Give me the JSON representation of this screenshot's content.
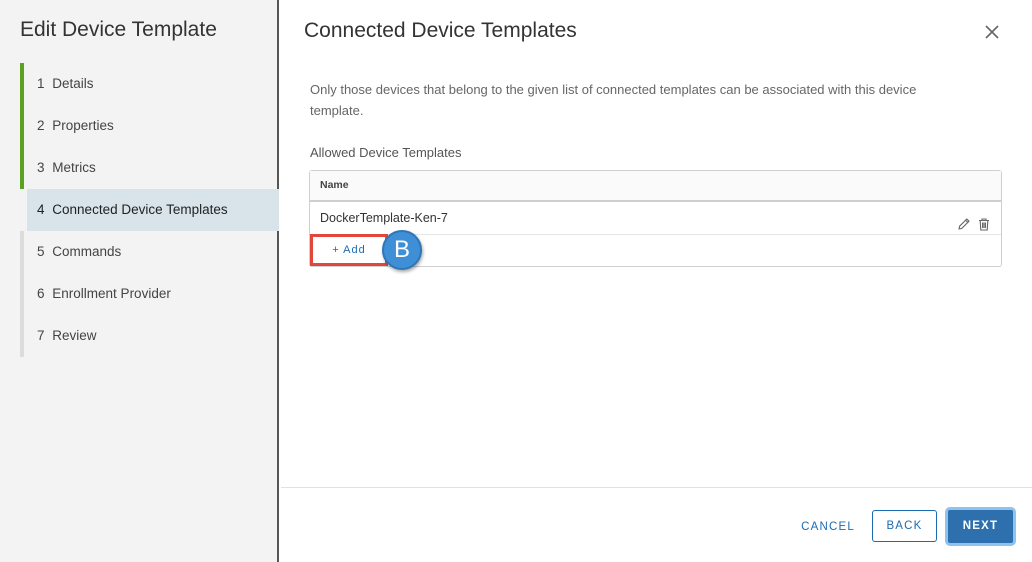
{
  "sidebar": {
    "title": "Edit Device Template",
    "steps": [
      {
        "num": "1",
        "label": "Details"
      },
      {
        "num": "2",
        "label": "Properties"
      },
      {
        "num": "3",
        "label": "Metrics"
      },
      {
        "num": "4",
        "label": "Connected Device Templates"
      },
      {
        "num": "5",
        "label": "Commands"
      },
      {
        "num": "6",
        "label": "Enrollment Provider"
      },
      {
        "num": "7",
        "label": "Review"
      }
    ]
  },
  "main": {
    "title": "Connected Device Templates",
    "description": "Only those devices that belong to the given list of connected templates can be associated with this device template.",
    "section_label": "Allowed Device Templates",
    "grid": {
      "column_header": "Name",
      "rows": [
        "DockerTemplate-Ken-7"
      ]
    },
    "add_label": "+ Add",
    "callout_marker": "B"
  },
  "footer": {
    "cancel_label": "CANCEL",
    "back_label": "BACK",
    "next_label": "NEXT"
  },
  "colors": {
    "accent": "#1a6bb0",
    "step_done": "#5aa220",
    "step_active_bg": "#d9e4ea",
    "highlight_border": "#e1473b",
    "marker_fill": "#3f8fd6",
    "primary_button": "#2e6fae"
  },
  "icons": {
    "close": "close-icon",
    "edit": "pencil-icon",
    "delete": "trash-icon"
  }
}
